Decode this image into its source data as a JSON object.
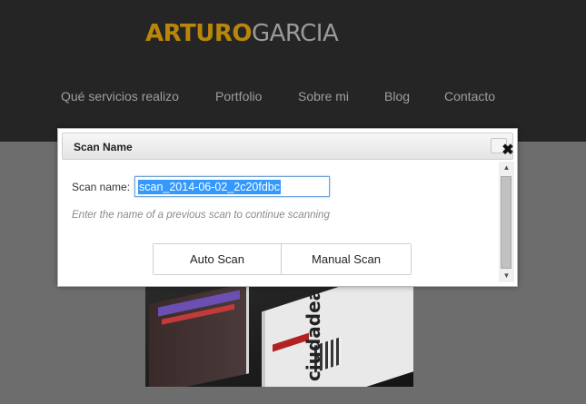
{
  "site": {
    "logo_first": "ARTURO",
    "logo_second": "GARCIA",
    "nav": [
      "Qué servicios realizo",
      "Portfolio",
      "Sobre mi",
      "Blog",
      "Contacto"
    ]
  },
  "photo": {
    "brand_text": "ciudadea"
  },
  "dialog": {
    "title": "Scan Name",
    "field_label": "Scan name:",
    "scan_name_value": "scan_2014-06-02_2c20fdbc",
    "hint": "Enter the name of a previous scan to continue scanning",
    "buttons": {
      "auto": "Auto Scan",
      "manual": "Manual Scan"
    },
    "close_glyph": "✖",
    "scroll_up_glyph": "▲",
    "scroll_down_glyph": "▼"
  },
  "colors": {
    "logo_accent": "#b8860b",
    "header_bg": "#252525",
    "overlay_bg": "#6d6d6d",
    "selection": "#3399ff"
  },
  "icons": [
    "close-icon",
    "scroll-up-icon",
    "scroll-down-icon"
  ]
}
